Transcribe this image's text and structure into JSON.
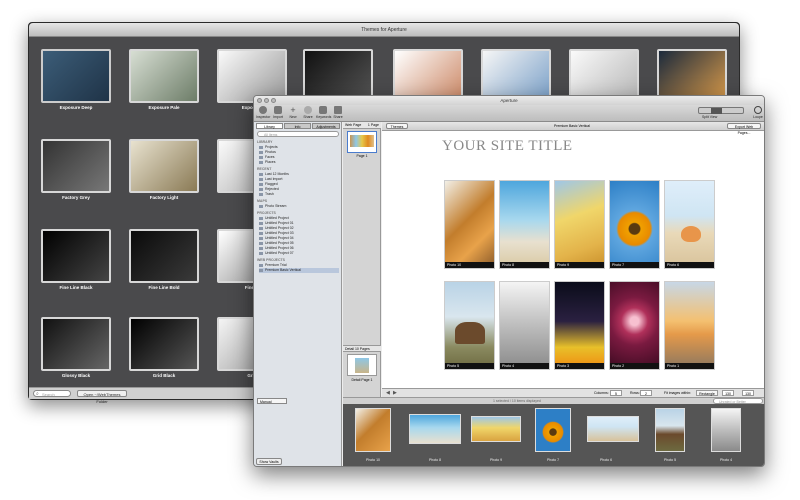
{
  "back_window": {
    "title": "Themes for Aperture",
    "themes": [
      {
        "label": "Exposure Deep"
      },
      {
        "label": "Exposure Pale"
      },
      {
        "label": "Exposure"
      },
      {
        "label": ""
      },
      {
        "label": ""
      },
      {
        "label": ""
      },
      {
        "label": ""
      },
      {
        "label": ""
      },
      {
        "label": "Factory Grey"
      },
      {
        "label": "Factory Light"
      },
      {
        "label": ""
      },
      {
        "label": "Fine Line Black"
      },
      {
        "label": "Fine Line Bold"
      },
      {
        "label": "Fine Li"
      },
      {
        "label": "Glossy Black"
      },
      {
        "label": "Grid Black"
      },
      {
        "label": "Grid"
      }
    ],
    "search_placeholder": "Search",
    "open_folder_label": "Open ~/WebThemes Folder"
  },
  "front_window": {
    "title": "Aperture",
    "toolbar": {
      "buttons": [
        "Inspector",
        "Import",
        "New",
        "Share",
        "Keywords",
        "Share"
      ],
      "split_view": "Split View",
      "loupe": "Loupe"
    },
    "sidebar": {
      "tabs": [
        "Library",
        "Info",
        "Adjustments"
      ],
      "search_placeholder": "All Items",
      "sections": {
        "library": "LIBRARY",
        "recent": "RECENT",
        "maps": "MAPS",
        "projects": "PROJECTS",
        "web_projects": "WEB PROJECTS"
      },
      "library_items": [
        "Projects",
        "Photos",
        "Faces",
        "Places"
      ],
      "recent_items": [
        "Last 12 Months",
        "Last Import",
        "Flagged",
        "Rejected",
        "Trash"
      ],
      "maps_items": [
        "Photo Stream"
      ],
      "project_items": [
        "Untitled Project",
        "Untitled Project 01",
        "Untitled Project 02",
        "Untitled Project 03",
        "Untitled Project 04",
        "Untitled Project 05",
        "Untitled Project 06",
        "Untitled Project 07"
      ],
      "web_items": [
        "Premium Trial",
        "Premium Basic Vertical"
      ],
      "show_vaults": "Show Vaults"
    },
    "content": {
      "themes_button": "Themes",
      "page_name": "Premium Basic Vertical",
      "export_button": "Export Web Pages...",
      "web_page_header": "Web Page",
      "page_count": "1 Page",
      "page_label": "Page 1",
      "detail_header": "Detail",
      "detail_count": "10 Pages",
      "detail_page_label": "Detail Page 1",
      "site_title": "YOUR SITE TITLE",
      "photos": [
        {
          "label": "Photo 10",
          "desc": "oranges"
        },
        {
          "label": "Photo 8",
          "desc": "beach"
        },
        {
          "label": "Photo 9",
          "desc": "car"
        },
        {
          "label": "Photo 7",
          "desc": "sunflower"
        },
        {
          "label": "Photo 6",
          "desc": "shell"
        },
        {
          "label": "Photo 5",
          "desc": "horses"
        },
        {
          "label": "Photo 4",
          "desc": "boat"
        },
        {
          "label": "Photo 3",
          "desc": "city"
        },
        {
          "label": "Photo 2",
          "desc": "rose"
        },
        {
          "label": "Photo 1",
          "desc": "sunset"
        }
      ],
      "controls": {
        "columns_label": "Columns:",
        "columns_value": "5",
        "rows_label": "Rows:",
        "rows_value": "2",
        "fit_label": "Fit images within:",
        "fit_mode": "Rectangle",
        "width_value": "130",
        "height_value": "130"
      },
      "status": "1 selected / 10 items displayed",
      "sort_mode": "Manual",
      "filter_placeholder": "Unrated or Better"
    },
    "filmstrip": [
      {
        "label": "Photo 10"
      },
      {
        "label": "Photo 8"
      },
      {
        "label": "Photo 9"
      },
      {
        "label": "Photo 7"
      },
      {
        "label": "Photo 6"
      },
      {
        "label": "Photo 5"
      },
      {
        "label": "Photo 4"
      }
    ]
  }
}
